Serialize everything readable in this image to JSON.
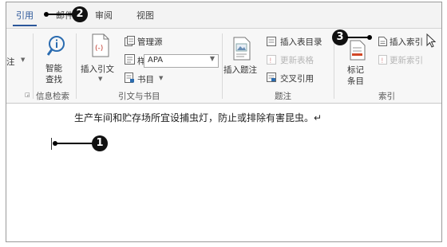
{
  "tabs": [
    "引用",
    "邮件",
    "审阅",
    "视图"
  ],
  "ribbon": {
    "footnote_fragment": "注",
    "smart_lookup": {
      "line1": "智能",
      "line2": "查找"
    },
    "insert_citation": "插入引文",
    "manage_sources": "管理源",
    "style_label": "样式:",
    "style_value": "APA",
    "bibliography": "书目",
    "insert_caption": "插入题注",
    "insert_table_of_figures": "插入表目录",
    "update_table": "更新表格",
    "cross_reference": "交叉引用",
    "mark_entry": {
      "line1": "标记",
      "line2": "条目"
    },
    "insert_index": "插入索引",
    "update_index": "更新索引",
    "groups": {
      "research": "信息检索",
      "citations": "引文与书目",
      "captions": "题注",
      "index": "索引"
    }
  },
  "document": {
    "text": "生产车间和贮存场所宜设捕虫灯，防止或排除有害昆虫。↵"
  },
  "callouts": [
    "1",
    "2",
    "3"
  ]
}
